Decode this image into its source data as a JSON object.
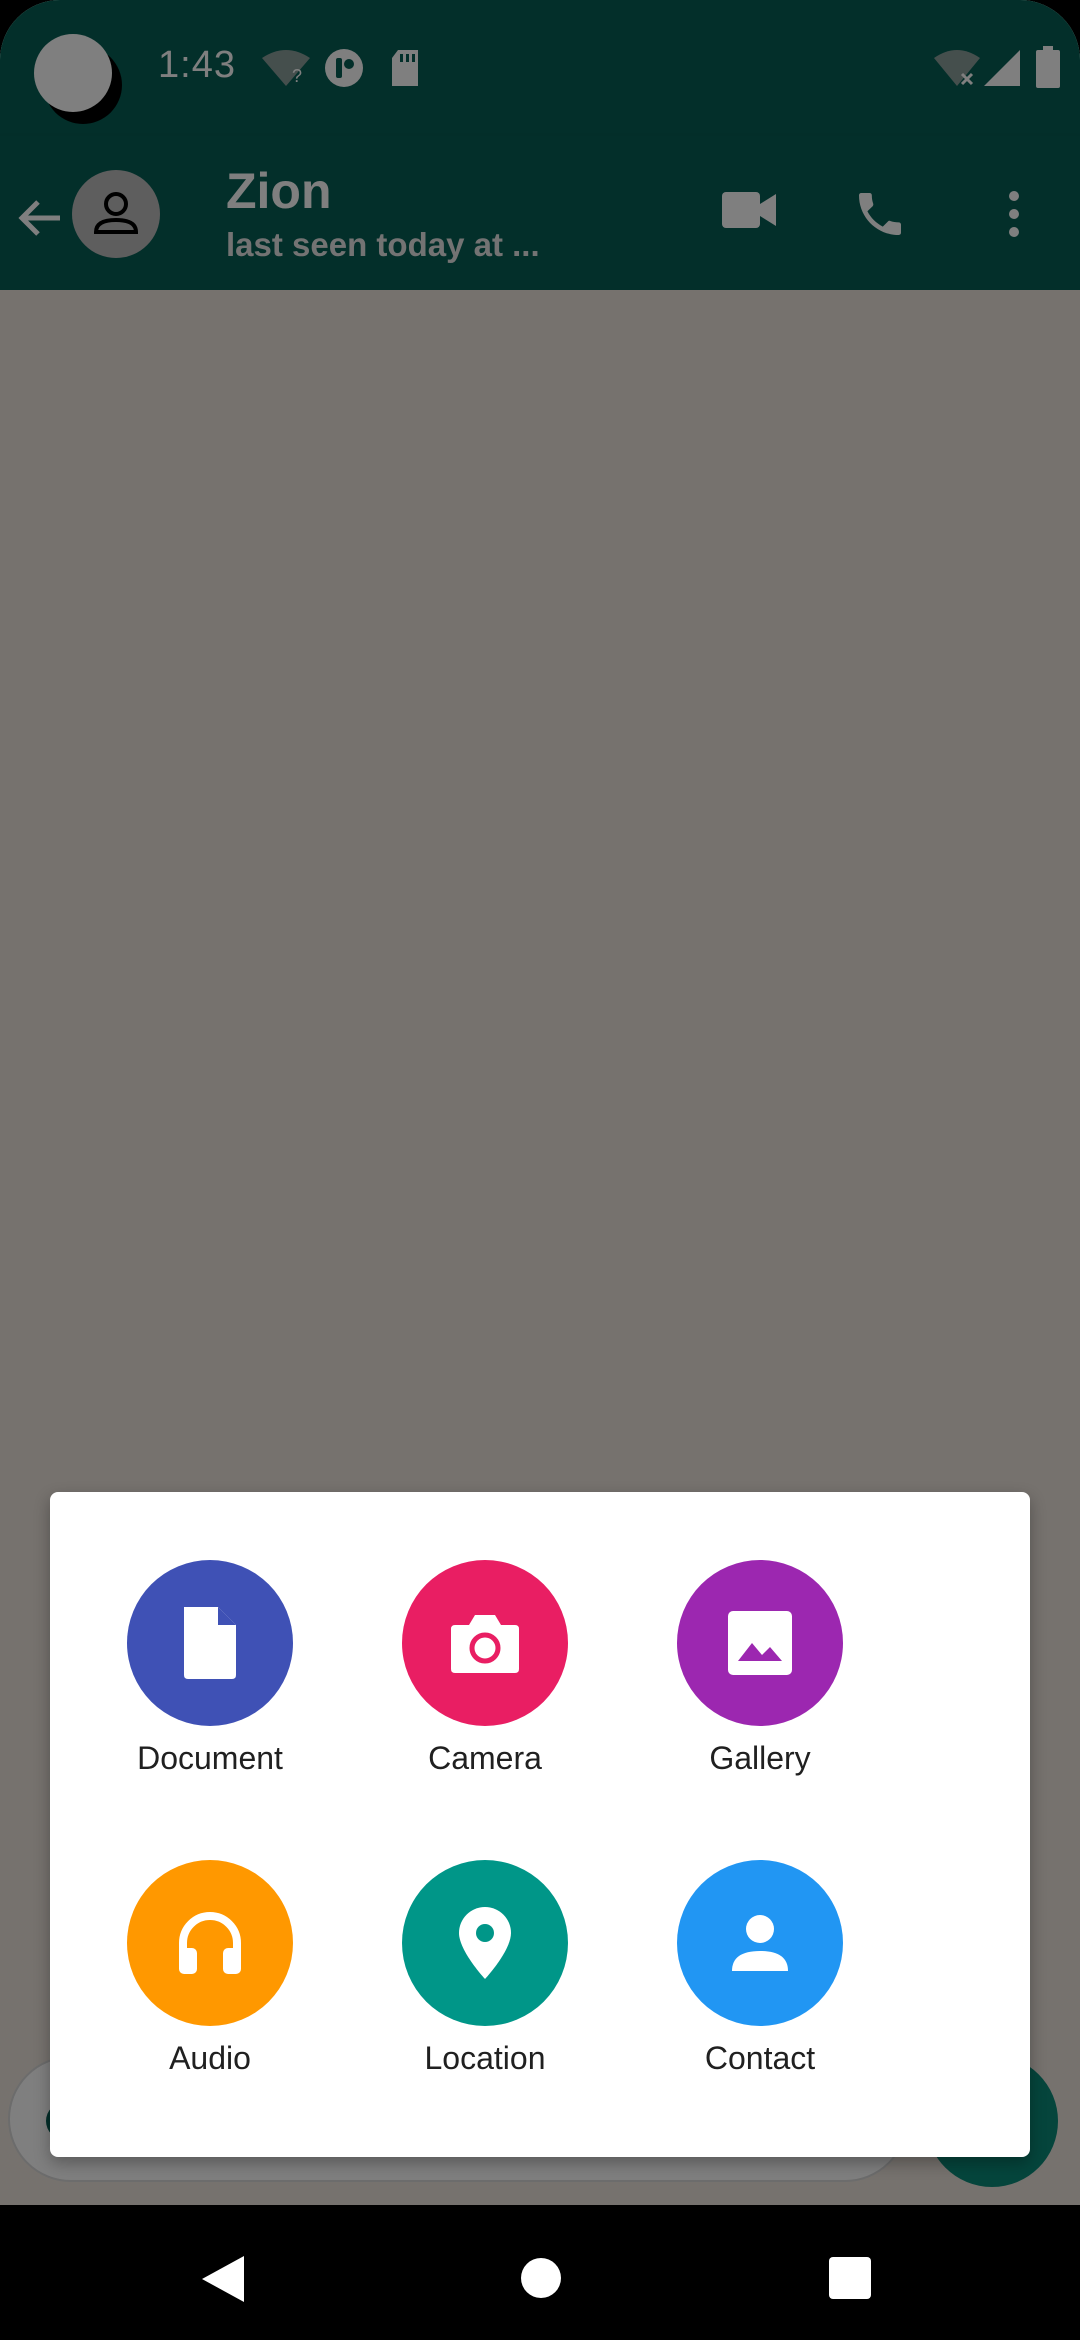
{
  "status_bar": {
    "time": "1:43"
  },
  "chat_header": {
    "contact_name": "Zion",
    "last_seen": "last seen today at ..."
  },
  "attachment_menu": {
    "options": [
      {
        "label": "Document",
        "icon": "document-icon",
        "color": "#3f51b5"
      },
      {
        "label": "Camera",
        "icon": "camera-icon",
        "color": "#e91e63"
      },
      {
        "label": "Gallery",
        "icon": "gallery-icon",
        "color": "#9c27b0"
      },
      {
        "label": "Audio",
        "icon": "headphones-icon",
        "color": "#ff9800"
      },
      {
        "label": "Location",
        "icon": "location-pin-icon",
        "color": "#009688"
      },
      {
        "label": "Contact",
        "icon": "person-icon",
        "color": "#2196f3"
      }
    ]
  },
  "colors": {
    "app_bar": "#075e54",
    "chat_background": "#ece5dd",
    "scrim": "rgba(0,0,0,0.5)"
  }
}
